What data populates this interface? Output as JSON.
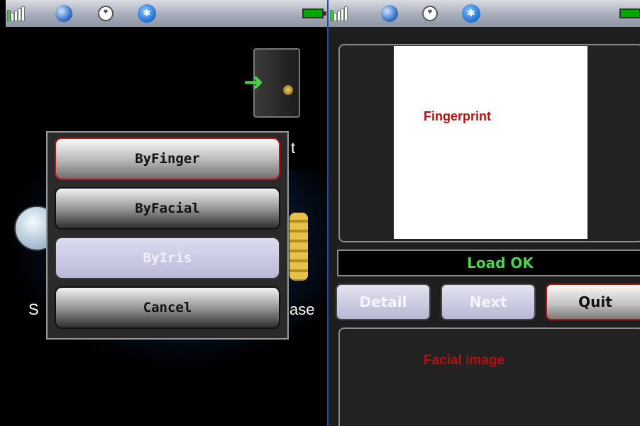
{
  "colors": {
    "status_ok": "#4bd34b",
    "label_red": "#b11212",
    "selected_border": "#b11111"
  },
  "status_bar": {
    "icons": [
      "signal-icon",
      "globe-icon",
      "wifi-icon",
      "bluetooth-icon",
      "battery-icon"
    ],
    "bluetooth_glyph": "✱",
    "wifi_glyph": "(ᵠ)"
  },
  "left_screen": {
    "background_fragments": {
      "exit_partial": "t",
      "left_partial": "S",
      "right_partial": "ase"
    },
    "menu": {
      "items": [
        {
          "label": "ByFinger",
          "state": "selected"
        },
        {
          "label": "ByFacial",
          "state": "normal"
        },
        {
          "label": "ByIris",
          "state": "disabled"
        },
        {
          "label": "Cancel",
          "state": "normal"
        }
      ]
    }
  },
  "right_screen": {
    "fingerprint_label": "Fingerprint",
    "status_text": "Load OK",
    "buttons": {
      "detail": "Detail",
      "next": "Next",
      "quit": "Quit"
    },
    "facial_label": "Facial image"
  }
}
